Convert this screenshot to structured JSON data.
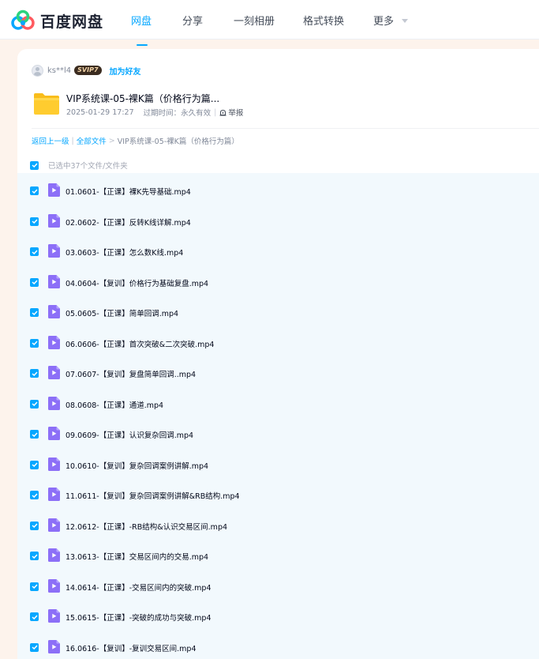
{
  "app": {
    "logo_text": "百度网盘",
    "brand_color": "#06a7ff"
  },
  "nav": {
    "items": [
      {
        "label": "网盘",
        "active": true
      },
      {
        "label": "分享",
        "active": false
      },
      {
        "label": "一刻相册",
        "active": false
      },
      {
        "label": "格式转换",
        "active": false
      },
      {
        "label": "更多",
        "active": false,
        "icon": "chevron-down-icon"
      }
    ]
  },
  "sharer": {
    "name": "ks**l4",
    "badge": "SVIP7",
    "add_friend": "加为好友",
    "avatar_icon": "user-icon"
  },
  "share": {
    "title": "VIP系统课-05-裸K篇（价格行为篇...",
    "date": "2025-01-29 17:27",
    "expire_label": "过期时间：永久有效",
    "report": "举报",
    "folder_icon": "folder-icon"
  },
  "breadcrumb": {
    "back": "返回上一级",
    "all_files": "全部文件",
    "separator_1": "|",
    "separator_2": ">",
    "current": "VIP系统课-05-裸K篇（价格行为篇）"
  },
  "selection": {
    "label": "已选中37个文件/文件夹",
    "checked": true
  },
  "files": [
    {
      "name": "01.0601-【正课】裸K先导基础.mp4",
      "checked": true
    },
    {
      "name": "02.0602-【正课】反转K线详解.mp4",
      "checked": true
    },
    {
      "name": "03.0603-【正课】怎么数K线.mp4",
      "checked": true
    },
    {
      "name": "04.0604-【复训】价格行为基础复盘.mp4",
      "checked": true
    },
    {
      "name": "05.0605-【正课】简单回调.mp4",
      "checked": true
    },
    {
      "name": "06.0606-【正课】首次突破&二次突破.mp4",
      "checked": true
    },
    {
      "name": "07.0607-【复训】复盘简单回调..mp4",
      "checked": true
    },
    {
      "name": "08.0608-【正课】通道.mp4",
      "checked": true
    },
    {
      "name": "09.0609-【正课】认识复杂回调.mp4",
      "checked": true
    },
    {
      "name": "10.0610-【复训】复杂回调案例讲解.mp4",
      "checked": true
    },
    {
      "name": "11.0611-【复训】复杂回调案例讲解&RB结构.mp4",
      "checked": true
    },
    {
      "name": "12.0612-【正课】-RB结构&认识交易区间.mp4",
      "checked": true
    },
    {
      "name": "13.0613-【正课】交易区间内的交易.mp4",
      "checked": true
    },
    {
      "name": "14.0614-【正课】-交易区间内的突破.mp4",
      "checked": true
    },
    {
      "name": "15.0615-【正课】-突破的成功与突破.mp4",
      "checked": true
    },
    {
      "name": "16.0616-【复训】-复训交易区间.mp4",
      "checked": true
    }
  ]
}
